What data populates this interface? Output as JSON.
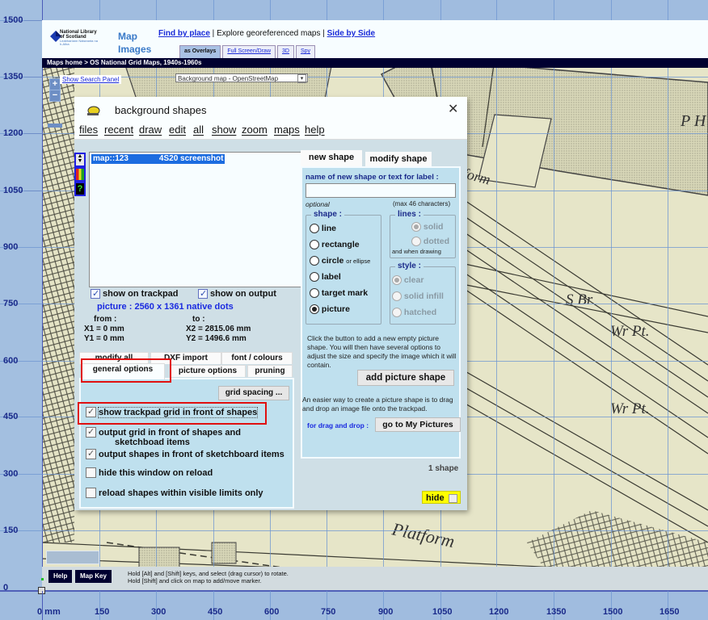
{
  "axes": {
    "y_unit": "mm",
    "y_ticks": [
      "1500",
      "1350",
      "1200",
      "1050",
      "900",
      "750",
      "600",
      "450",
      "300",
      "150",
      "0"
    ],
    "x_ticks": [
      "0  mm",
      "150",
      "300",
      "450",
      "600",
      "750",
      "900",
      "1050",
      "1200",
      "1350",
      "1500",
      "1650"
    ]
  },
  "header": {
    "logo": {
      "line1": "National Library",
      "line2": "of Scotland",
      "line3": "Leabharlann Nàiseanta na h-Alba"
    },
    "map_images": {
      "line1": "Map",
      "line2": "Images"
    },
    "nav": {
      "find_by_place": "Find by place",
      "sep1": " | ",
      "explore": "Explore georeferenced maps",
      "sep2": " | ",
      "side_by_side": "Side by Side"
    },
    "view_tabs": [
      "as Overlays",
      "Full Screen/Draw",
      "3D",
      "Spy"
    ],
    "active_view_tab": "as Overlays",
    "breadcrumb": "Maps home  >  OS National Grid Maps, 1940s-1960s"
  },
  "map_controls": {
    "show_search_panel": "Show Search Panel",
    "zoom_in": "+",
    "zoom_out": "−",
    "background_map_select": "Background map - OpenStreetMap"
  },
  "map_labels": [
    "form",
    "P H",
    "S Br",
    "Wr Pt.",
    "Wr Pt.",
    "Platform"
  ],
  "dialog": {
    "title": "background  shapes",
    "close": "✕",
    "menu": [
      "files",
      "recent",
      "draw",
      "edit",
      "all",
      "show",
      "zoom",
      "maps",
      "help"
    ],
    "list": {
      "selected_item_id": "map::123",
      "selected_item_name": "4S20 screenshot"
    },
    "show_on_trackpad": {
      "label": "show  on  trackpad",
      "checked": true
    },
    "show_on_output": {
      "label": "show  on  output",
      "checked": true
    },
    "picture_info": "picture :  2560  x  1361  native  dots",
    "from_label": "from :",
    "to_label": "to :",
    "x1": "X1 =  0 mm",
    "y1": "Y1 =  0 mm",
    "x2": "X2 =  2815.06 mm",
    "y2": "Y2 =  1496.6 mm",
    "option_tabs_row1": [
      "modify  all",
      "DXF  import",
      "font / colours"
    ],
    "option_tabs_row2": [
      "general  options",
      "picture  options",
      "pruning"
    ],
    "active_option_tab": "general  options",
    "grid_spacing_button": "grid  spacing ...",
    "options": [
      {
        "label": "show  trackpad  grid  in  front  of  shapes",
        "checked": true
      },
      {
        "label": "output  grid  in  front  of  shapes  and",
        "label2": "sketchboad  items",
        "checked": true
      },
      {
        "label": "output  shapes  in  front  of  sketchboard  items",
        "checked": true
      },
      {
        "label": "hide  this  window  on  reload",
        "checked": false
      },
      {
        "label": "reload  shapes  within  visible  limits  only",
        "checked": false
      }
    ],
    "right_tabs": [
      "new  shape",
      "modify  shape"
    ],
    "active_right_tab": "new  shape",
    "name_label": "name of new shape  or  text for label :",
    "name_value": "",
    "optional": "optional",
    "max_chars": "(max 46 characters)",
    "shape_legend": "shape :",
    "shape_options": [
      "line",
      "rectangle",
      "circle",
      "label",
      "target mark",
      "picture"
    ],
    "circle_suffix": "or ellipse",
    "selected_shape": "picture",
    "lines_legend": "lines :",
    "line_options": [
      "solid",
      "dotted"
    ],
    "line_note": "and when drawing",
    "style_legend": "style :",
    "style_options": [
      "clear",
      "solid infill",
      "hatched"
    ],
    "help_text_1": "Click the button to add a new empty picture shape. You will then have several options to adjust the size and specify the image which it will contain.",
    "add_picture_button": "add  picture  shape",
    "help_text_2": "An easier way to create a picture shape is to drag and drop an image file onto the trackpad.",
    "drag_drop_label": "for drag and drop :",
    "my_pictures_button": "go  to  My Pictures",
    "shape_count": "1  shape",
    "hide_button": "hide"
  },
  "bottom": {
    "help": "Help",
    "map_key": "Map Key",
    "hint1": "Hold [Alt] and [Shift] keys, and select (drag cursor) to rotate.",
    "hint2": "Hold [Shift] and click on map to add/move marker."
  }
}
